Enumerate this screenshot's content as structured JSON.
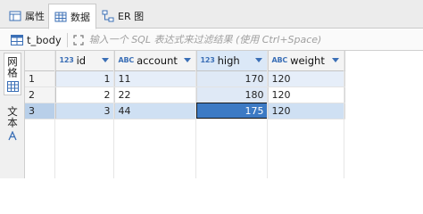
{
  "tabs": [
    {
      "label": "属性",
      "icon": "properties-icon",
      "active": false
    },
    {
      "label": "数据",
      "icon": "data-grid-icon",
      "active": true
    },
    {
      "label": "ER 图",
      "icon": "er-diagram-icon",
      "active": false
    }
  ],
  "filter": {
    "table_name": "t_body",
    "placeholder": "输入一个 SQL 表达式来过滤结果 (使用 Ctrl+Space)"
  },
  "side_panel": {
    "grid_label": "网格",
    "text_label": "文本"
  },
  "grid": {
    "columns": [
      {
        "type": "123",
        "name": "id",
        "icon": "numeric-type-icon"
      },
      {
        "type": "ABC",
        "name": "account",
        "icon": "text-type-icon"
      },
      {
        "type": "123",
        "name": "high",
        "icon": "numeric-type-icon"
      },
      {
        "type": "ABC",
        "name": "weight",
        "icon": "text-type-icon"
      }
    ],
    "rows": [
      {
        "num": "1",
        "id": "1",
        "account": "11",
        "high": "170",
        "weight": "120"
      },
      {
        "num": "2",
        "id": "2",
        "account": "22",
        "high": "180",
        "weight": "120"
      },
      {
        "num": "3",
        "id": "3",
        "account": "44",
        "high": "175",
        "weight": "120"
      }
    ],
    "selected_row": 3,
    "selected_column": "high"
  },
  "colors": {
    "accent": "#3c7ac4",
    "selected_row": "#cfe0f3",
    "type_icon": "#3b6fb6"
  }
}
